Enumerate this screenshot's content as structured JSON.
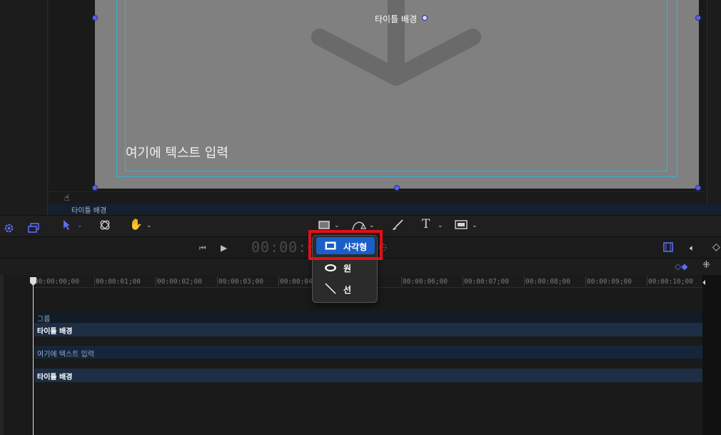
{
  "canvas": {
    "title_handle_label": "타이틀 배경",
    "placeholder_text": "여기에 텍스트 입력"
  },
  "layer_bar": {
    "label": "타이틀 배경"
  },
  "toolbar": {
    "icons": [
      "gear-icon",
      "windows-icon",
      "select-arrow-icon",
      "orbit-icon",
      "hand-icon",
      "rectangle-shape-icon",
      "pen-icon",
      "brush-icon",
      "text-tool-icon",
      "mask-icon"
    ]
  },
  "transport": {
    "timecode": "00:00:00"
  },
  "shape_menu": {
    "items": [
      {
        "label": "사각형",
        "icon": "rectangle-icon",
        "selected": true
      },
      {
        "label": "원",
        "icon": "ellipse-icon",
        "selected": false
      },
      {
        "label": "선",
        "icon": "line-icon",
        "selected": false
      }
    ]
  },
  "timeline": {
    "ruler_ticks": [
      "00:00:00;00",
      "00:00:01;00",
      "00:00:02;00",
      "00:00:03;00",
      "00:00:04",
      "00:00:06;00",
      "00:00:07;00",
      "00:00:08;00",
      "00:00:09;00",
      "00:00:10;00"
    ],
    "tracks": [
      {
        "label": "그룹"
      },
      {
        "label": "타이틀 배경"
      },
      {
        "label": "여기에 텍스트 입력"
      },
      {
        "label": "타이틀 배경"
      }
    ]
  },
  "colors": {
    "accent": "#1a5fc9",
    "highlight": "#e0101a",
    "guide": "#2fb6d6",
    "handle": "#5861e6"
  }
}
